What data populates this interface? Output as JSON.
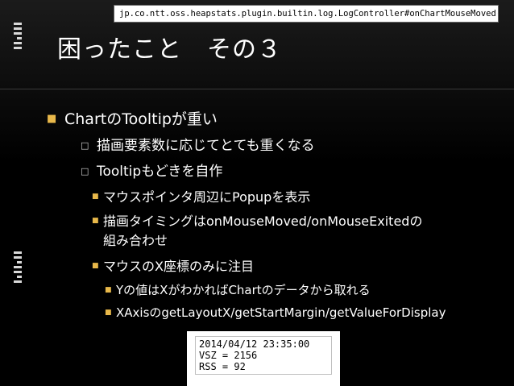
{
  "callout": {
    "text": "jp.co.ntt.oss.heapstats.plugin.builtin.log.LogController#onChartMouseMoved()"
  },
  "slide": {
    "title": "困ったこと　その３"
  },
  "bullets": [
    {
      "level": 1,
      "text": "ChartのTooltipが重い"
    },
    {
      "level": 2,
      "text": "描画要素数に応じてとても重くなる"
    },
    {
      "level": 2,
      "text": "Tooltipもどきを自作"
    },
    {
      "level": 3,
      "text": "マウスポインタ周辺にPopupを表示"
    },
    {
      "level": 3,
      "text": "描画タイミングはonMouseMoved/onMouseExitedの"
    },
    {
      "level": 3,
      "text": "組み合わせ"
    },
    {
      "level": 3,
      "text": "マウスのX座標のみに注目"
    },
    {
      "level": 4,
      "text": "Yの値はXがわかればChartのデータから取れる"
    },
    {
      "level": 4,
      "text": "XAxisのgetLayoutX/getStartMargin/getValueForDisplay"
    }
  ],
  "tooltip_sample": {
    "line1": "2014/04/12 23:35:00",
    "line2": "VSZ = 2156",
    "line3": "RSS = 92"
  },
  "colors": {
    "bullet_accent": "#e8b84a",
    "background": "#000000",
    "text": "#ffffff"
  }
}
